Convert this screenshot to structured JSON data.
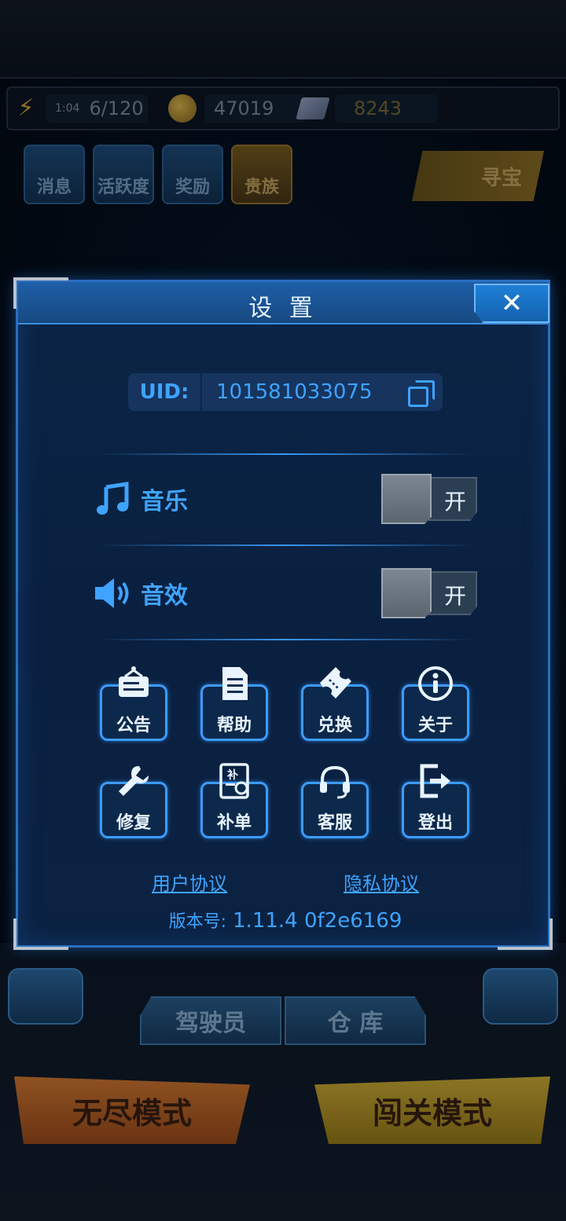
{
  "hud": {
    "timer": "1:04",
    "energy": "6/120",
    "coins": "47019",
    "gems": "8243"
  },
  "top_menu": [
    {
      "label": "消息",
      "icon": "envelope-icon"
    },
    {
      "label": "活跃度",
      "icon": "smile-badge-icon"
    },
    {
      "label": "奖励",
      "icon": "gift-icon"
    },
    {
      "label": "贵族",
      "icon": "v-badge-icon"
    }
  ],
  "treasure_label": "寻宝",
  "settings": {
    "title": "设 置",
    "uid_label": "UID:",
    "uid_value": "101581033075",
    "music": {
      "label": "音乐",
      "toggle_text": "开"
    },
    "sound": {
      "label": "音效",
      "toggle_text": "开"
    },
    "grid": [
      {
        "label": "公告",
        "icon": "notice-board-icon"
      },
      {
        "label": "帮助",
        "icon": "document-icon"
      },
      {
        "label": "兑换",
        "icon": "ticket-icon"
      },
      {
        "label": "关于",
        "icon": "info-icon"
      },
      {
        "label": "修复",
        "icon": "wrench-icon"
      },
      {
        "label": "补单",
        "icon": "refill-order-icon"
      },
      {
        "label": "客服",
        "icon": "headset-icon"
      },
      {
        "label": "登出",
        "icon": "logout-icon"
      }
    ],
    "user_agreement": "用户协议",
    "privacy_policy": "隐私协议",
    "version_label": "版本号:",
    "version_value": "1.11.4  0f2e6169"
  },
  "bottom": {
    "pilot": "驾驶员",
    "depot": "仓 库",
    "endless_mode": "无尽模式",
    "stage_mode": "闯关模式"
  },
  "colors": {
    "accent_blue": "#3fa3ff",
    "dialog_bg": "#0b2546",
    "header_blue": "#1e5fa8",
    "toggle_knob": "#6c7782"
  }
}
